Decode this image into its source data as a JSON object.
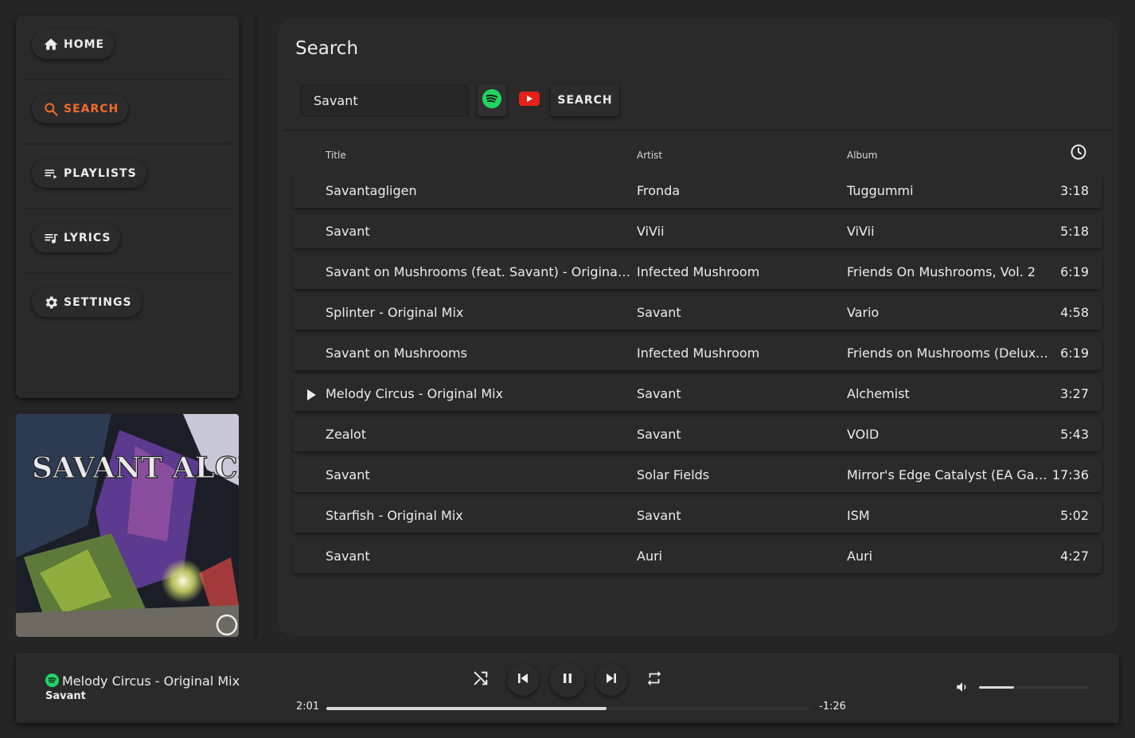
{
  "sidebar": {
    "items": [
      {
        "label": "HOME",
        "icon": "home-icon",
        "active": false
      },
      {
        "label": "SEARCH",
        "icon": "search-icon",
        "active": true
      },
      {
        "label": "PLAYLISTS",
        "icon": "playlist-icon",
        "active": false
      },
      {
        "label": "LYRICS",
        "icon": "lyrics-icon",
        "active": false
      },
      {
        "label": "SETTINGS",
        "icon": "gear-icon",
        "active": false
      }
    ]
  },
  "main": {
    "title": "Search",
    "search": {
      "value": "Savant",
      "button_label": "SEARCH"
    },
    "columns": {
      "title": "Title",
      "artist": "Artist",
      "album": "Album"
    },
    "rows": [
      {
        "title": "Savantagligen",
        "artist": "Fronda",
        "album": "Tuggummi",
        "duration": "3:18"
      },
      {
        "title": "Savant",
        "artist": "ViVii",
        "album": "ViVii",
        "duration": "5:18"
      },
      {
        "title": "Savant on Mushrooms (feat. Savant) - Original Mix",
        "artist": "Infected Mushroom",
        "album": "Friends On Mushrooms, Vol. 2",
        "duration": "6:19"
      },
      {
        "title": "Splinter - Original Mix",
        "artist": "Savant",
        "album": "Vario",
        "duration": "4:58"
      },
      {
        "title": "Savant on Mushrooms",
        "artist": "Infected Mushroom",
        "album": "Friends on Mushrooms (Deluxe Ed...",
        "duration": "6:19"
      },
      {
        "title": "Melody Circus - Original Mix",
        "artist": "Savant",
        "album": "Alchemist",
        "duration": "3:27",
        "playing": true
      },
      {
        "title": "Zealot",
        "artist": "Savant",
        "album": "VOID",
        "duration": "5:43"
      },
      {
        "title": "Savant",
        "artist": "Solar Fields",
        "album": "Mirror's Edge Catalyst (EA Games ...",
        "duration": "17:36"
      },
      {
        "title": "Starfish - Original Mix",
        "artist": "Savant",
        "album": "ISM",
        "duration": "5:02"
      },
      {
        "title": "Savant",
        "artist": "Auri",
        "album": "Auri",
        "duration": "4:27"
      }
    ]
  },
  "album_art": {
    "text": "SAVANT ALCHEMIST"
  },
  "player": {
    "title": "Melody Circus - Original Mix",
    "artist": "Savant",
    "elapsed": "2:01",
    "remaining": "-1:26",
    "progress": 0.58,
    "volume": 0.32
  },
  "colors": {
    "accent": "#f36b2a",
    "spotify": "#1ed760",
    "youtube": "#e62117"
  }
}
